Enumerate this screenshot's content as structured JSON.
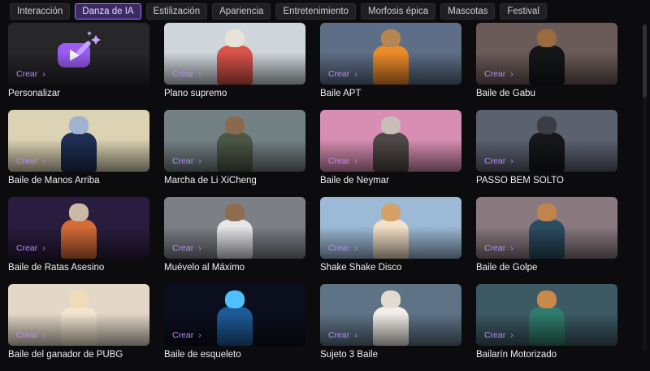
{
  "tabs": [
    {
      "label": "Interacción",
      "active": false
    },
    {
      "label": "Danza de IA",
      "active": true
    },
    {
      "label": "Estilización",
      "active": false
    },
    {
      "label": "Apariencia",
      "active": false
    },
    {
      "label": "Entretenimiento",
      "active": false
    },
    {
      "label": "Morfosis épica",
      "active": false
    },
    {
      "label": "Mascotas",
      "active": false
    },
    {
      "label": "Festival",
      "active": false
    }
  ],
  "create_label": "Crear",
  "create_arrow": "›",
  "colors": {
    "accent": "#9b7bff",
    "create_text": "#b98bff",
    "background": "#0c0c0e"
  },
  "cards": [
    {
      "title": "Personalizar",
      "bg": "#26262b",
      "icon": "ai-video-icon"
    },
    {
      "title": "Plano supremo",
      "bg": "#cfd6dc",
      "head": "#e9e2d9",
      "body": "#d9534a"
    },
    {
      "title": "Baile APT",
      "bg": "#5d6e86",
      "head": "#b38652",
      "body": "#ee8c2a"
    },
    {
      "title": "Baile de Gabu",
      "bg": "#6b5b58",
      "head": "#9a6b3f",
      "body": "#15161a"
    },
    {
      "title": "Baile de Manos Arriba",
      "bg": "#dcd2b4",
      "head": "#9fb2cf",
      "body": "#1f2f54"
    },
    {
      "title": "Marcha de Li XiCheng",
      "bg": "#748184",
      "head": "#8a6a4d",
      "body": "#4c5847"
    },
    {
      "title": "Baile de Neymar",
      "bg": "#d88db2",
      "head": "#c7bfb7",
      "body": "#4f4847"
    },
    {
      "title": "PASSO BEM SOLTO",
      "bg": "#5c6170",
      "head": "#3c3c44",
      "body": "#16171b"
    },
    {
      "title": "Baile de Ratas Asesino",
      "bg": "#2a1c3e",
      "head": "#c9b9a5",
      "body": "#d56c37"
    },
    {
      "title": "Muévelo al Máximo",
      "bg": "#7c8086",
      "head": "#8f6c4e",
      "body": "#e7e7ea"
    },
    {
      "title": "Shake Shake Disco",
      "bg": "#9cbad6",
      "head": "#d2a268",
      "body": "#f3e1c8"
    },
    {
      "title": "Baile de Golpe",
      "bg": "#8a7a80",
      "head": "#c2844f",
      "body": "#2b4d61"
    },
    {
      "title": "Baile del ganador de PUBG",
      "bg": "#e3d7c7",
      "head": "#f0dcb8",
      "body": "#f2e4cf"
    },
    {
      "title": "Baile de esqueleto",
      "bg": "#0b0e1c",
      "head": "#4fc0ff",
      "body": "#1d5a98"
    },
    {
      "title": "Sujeto 3 Baile",
      "bg": "#5e7386",
      "head": "#e3dbd2",
      "body": "#f1ede8"
    },
    {
      "title": "Bailarín Motorizado",
      "bg": "#3c5964",
      "head": "#c9894b",
      "body": "#2f7c6c"
    }
  ]
}
